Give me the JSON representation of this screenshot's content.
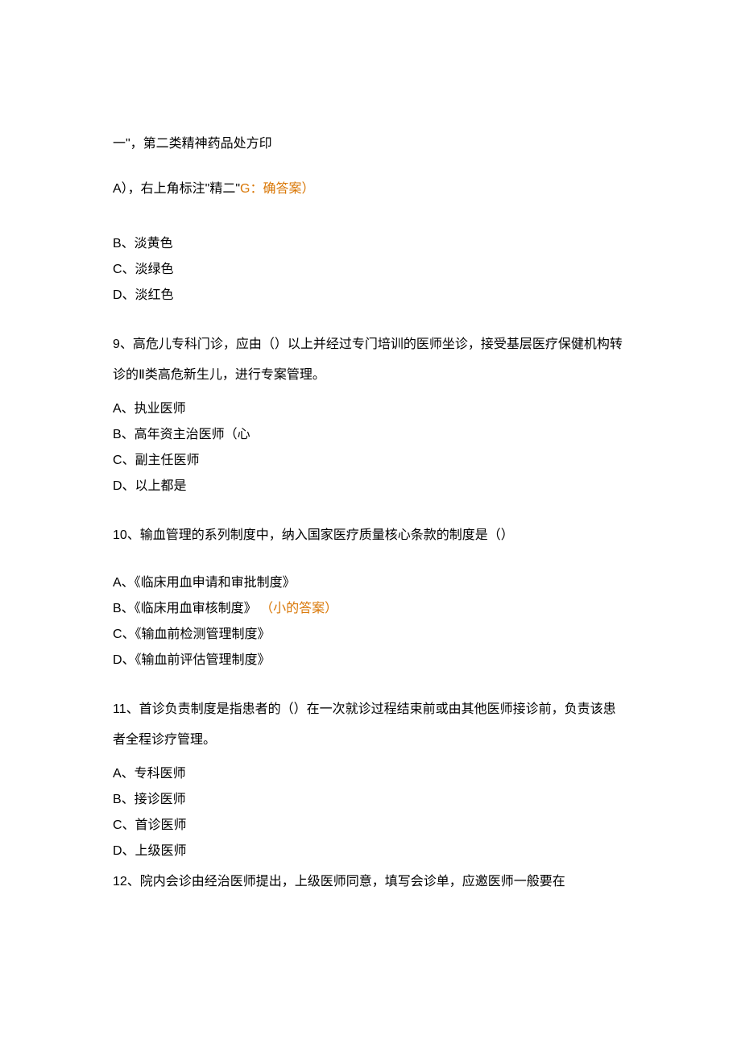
{
  "header": {
    "line1": "一\"，第二类精神药品处方印",
    "line2_a": "A），右上角标注\"精二\"",
    "line2_b": "G：确答案）"
  },
  "q8": {
    "options": {
      "B": "B、淡黄色",
      "C": "C、淡绿色",
      "D": "D、淡红色"
    }
  },
  "q9": {
    "stem": "9、高危儿专科门诊，应由（）以上并经过专门培训的医师坐诊，接受基层医疗保健机构转诊的Ⅱ类高危新生儿，进行专案管理。",
    "options": {
      "A": "A、执业医师",
      "B": "B、高年资主治医师（心",
      "C": "C、副主任医师",
      "D": "D、以上都是"
    }
  },
  "q10": {
    "stem": "10、输血管理的系列制度中，纳入国家医疗质量核心条款的制度是（）",
    "options": {
      "A": "A、《临床用血申请和审批制度》",
      "B": "B、《临床用血审核制度》",
      "B_note": "（小的答案）",
      "C": "C、《输血前检测管理制度》",
      "D": "D、《输血前评估管理制度》"
    }
  },
  "q11": {
    "stem": "11、首诊负责制度是指患者的（）在一次就诊过程结束前或由其他医师接诊前，负责该患者全程诊疗管理。",
    "options": {
      "A": "A、专科医师",
      "B": "B、接诊医师",
      "C": "C、首诊医师",
      "D": "D、上级医师"
    }
  },
  "q12": {
    "stem": "12、院内会诊由经治医师提出，上级医师同意，填写会诊单，应邀医师一般要在"
  }
}
